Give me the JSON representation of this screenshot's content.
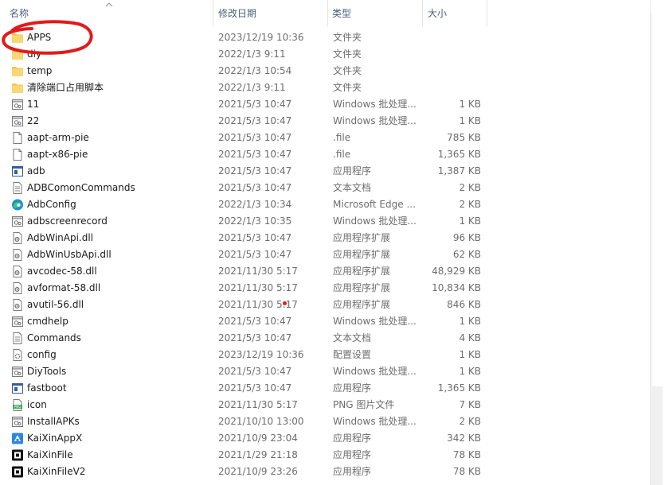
{
  "columns": {
    "name": "名称",
    "date": "修改日期",
    "type": "类型",
    "size": "大小"
  },
  "files": [
    {
      "name": "APPS",
      "date": "2023/12/19 10:36",
      "type": "文件夹",
      "size": "",
      "icon": "folder-icon"
    },
    {
      "name": "diy",
      "date": "2022/1/3 9:11",
      "type": "文件夹",
      "size": "",
      "icon": "folder-icon"
    },
    {
      "name": "temp",
      "date": "2022/1/3 10:54",
      "type": "文件夹",
      "size": "",
      "icon": "folder-icon"
    },
    {
      "name": "清除端口占用脚本",
      "date": "2022/1/3 9:11",
      "type": "文件夹",
      "size": "",
      "icon": "folder-icon"
    },
    {
      "name": "11",
      "date": "2021/5/3 10:47",
      "type": "Windows 批处理...",
      "size": "1 KB",
      "icon": "batch-file-icon"
    },
    {
      "name": "22",
      "date": "2021/5/3 10:47",
      "type": "Windows 批处理...",
      "size": "1 KB",
      "icon": "batch-file-icon"
    },
    {
      "name": "aapt-arm-pie",
      "date": "2021/5/3 10:47",
      "type": ".file",
      "size": "785 KB",
      "icon": "blank-file-icon"
    },
    {
      "name": "aapt-x86-pie",
      "date": "2021/5/3 10:47",
      "type": ".file",
      "size": "1,365 KB",
      "icon": "blank-file-icon"
    },
    {
      "name": "adb",
      "date": "2021/5/3 10:47",
      "type": "应用程序",
      "size": "1,387 KB",
      "icon": "application-icon"
    },
    {
      "name": "ADBComonCommands",
      "date": "2021/5/3 10:47",
      "type": "文本文档",
      "size": "2 KB",
      "icon": "text-document-icon"
    },
    {
      "name": "AdbConfig",
      "date": "2022/1/3 10:34",
      "type": "Microsoft Edge ...",
      "size": "2 KB",
      "icon": "edge-icon"
    },
    {
      "name": "adbscreenrecord",
      "date": "2022/1/3 10:35",
      "type": "Windows 批处理...",
      "size": "1 KB",
      "icon": "batch-file-icon"
    },
    {
      "name": "AdbWinApi.dll",
      "date": "2021/5/3 10:47",
      "type": "应用程序扩展",
      "size": "96 KB",
      "icon": "dll-icon"
    },
    {
      "name": "AdbWinUsbApi.dll",
      "date": "2021/5/3 10:47",
      "type": "应用程序扩展",
      "size": "62 KB",
      "icon": "dll-icon"
    },
    {
      "name": "avcodec-58.dll",
      "date": "2021/11/30 5:17",
      "type": "应用程序扩展",
      "size": "48,929 KB",
      "icon": "dll-icon"
    },
    {
      "name": "avformat-58.dll",
      "date": "2021/11/30 5:17",
      "type": "应用程序扩展",
      "size": "10,834 KB",
      "icon": "dll-icon"
    },
    {
      "name": "avutil-56.dll",
      "date": "2021/11/30 5:17",
      "type": "应用程序扩展",
      "size": "846 KB",
      "icon": "dll-icon"
    },
    {
      "name": "cmdhelp",
      "date": "2021/5/3 10:47",
      "type": "Windows 批处理...",
      "size": "1 KB",
      "icon": "batch-file-icon"
    },
    {
      "name": "Commands",
      "date": "2021/5/3 10:47",
      "type": "文本文档",
      "size": "4 KB",
      "icon": "text-document-icon"
    },
    {
      "name": "config",
      "date": "2023/12/19 10:36",
      "type": "配置设置",
      "size": "1 KB",
      "icon": "config-file-icon"
    },
    {
      "name": "DiyTools",
      "date": "2021/5/3 10:47",
      "type": "Windows 批处理...",
      "size": "1 KB",
      "icon": "batch-file-icon"
    },
    {
      "name": "fastboot",
      "date": "2021/5/3 10:47",
      "type": "应用程序",
      "size": "1,365 KB",
      "icon": "application-icon"
    },
    {
      "name": "icon",
      "date": "2021/11/30 5:17",
      "type": "PNG 图片文件",
      "size": "7 KB",
      "icon": "png-image-icon"
    },
    {
      "name": "InstallAPKs",
      "date": "2021/10/10 13:00",
      "type": "Windows 批处理...",
      "size": "2 KB",
      "icon": "batch-file-icon"
    },
    {
      "name": "KaiXinAppX",
      "date": "2021/10/9 23:04",
      "type": "应用程序",
      "size": "342 KB",
      "icon": "kaixin-app-icon"
    },
    {
      "name": "KaiXinFile",
      "date": "2021/1/29 21:18",
      "type": "应用程序",
      "size": "78 KB",
      "icon": "black-app-icon"
    },
    {
      "name": "KaiXinFileV2",
      "date": "2021/10/9 23:26",
      "type": "应用程序",
      "size": "78 KB",
      "icon": "black-app-icon"
    }
  ],
  "colors": {
    "header_text": "#4c607a",
    "folder": "#f4c542",
    "annotation": "#e01b1b"
  }
}
